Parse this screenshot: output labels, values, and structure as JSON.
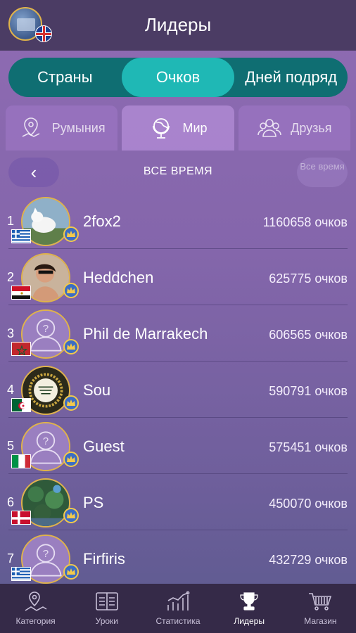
{
  "header": {
    "title": "Лидеры"
  },
  "segments": [
    "Страны",
    "Очков",
    "Дней подряд"
  ],
  "tabs": [
    {
      "label": "Румыния",
      "icon": "location-pin-icon"
    },
    {
      "label": "Мир",
      "icon": "globe-icon"
    },
    {
      "label": "Друзья",
      "icon": "friends-icon"
    }
  ],
  "period": {
    "label": "ВСЕ ВРЕМЯ",
    "all_label": "Все время"
  },
  "leaders": [
    {
      "rank": "1",
      "name": "2fox2",
      "score": "1160658 очков",
      "flag": "Greece"
    },
    {
      "rank": "2",
      "name": "Heddchen",
      "score": "625775 очков",
      "flag": "Egypt"
    },
    {
      "rank": "3",
      "name": "Phil de Marrakech",
      "score": "606565 очков",
      "flag": "Morocco"
    },
    {
      "rank": "4",
      "name": "Sou",
      "score": "590791 очков",
      "flag": "Algeria"
    },
    {
      "rank": "5",
      "name": "Guest",
      "score": "575451 очков",
      "flag": "Italy"
    },
    {
      "rank": "6",
      "name": "PS",
      "score": "450070 очков",
      "flag": "Denmark"
    },
    {
      "rank": "7",
      "name": "Firfiris",
      "score": "432729 очков",
      "flag": "Greece"
    }
  ],
  "bottom_nav": [
    {
      "label": "Категория",
      "icon": "map-icon"
    },
    {
      "label": "Уроки",
      "icon": "lessons-icon"
    },
    {
      "label": "Статистика",
      "icon": "stats-chart-icon"
    },
    {
      "label": "Лидеры",
      "icon": "trophy-icon"
    },
    {
      "label": "Магазин",
      "icon": "cart-icon"
    }
  ],
  "colors": {
    "segment_bg": "#0f6e72",
    "segment_active": "#1fb8b5",
    "header_bg": "#4b3c64",
    "nav_bg": "#352a48"
  }
}
